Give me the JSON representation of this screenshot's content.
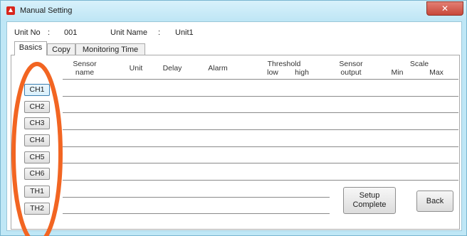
{
  "window": {
    "title": "Manual Setting",
    "close_symbol": "✕",
    "accent_color": "#bfe7f6"
  },
  "unit": {
    "no_label": "Unit No",
    "no_colon": ":",
    "no_value": "001",
    "name_label": "Unit Name",
    "name_colon": ":",
    "name_value": "Unit1"
  },
  "tabs": [
    {
      "label": "Basics",
      "active": true
    },
    {
      "label": "Copy",
      "active": false
    },
    {
      "label": "Monitoring Time",
      "active": false
    }
  ],
  "headers": {
    "sensor_name_1": "Sensor",
    "sensor_name_2": "name",
    "unit": "Unit",
    "delay": "Delay",
    "alarm": "Alarm",
    "threshold": "Threshold",
    "low": "low",
    "high": "high",
    "sensor_output_1": "Sensor",
    "sensor_output_2": "output",
    "scale": "Scale",
    "min": "Min",
    "max": "Max"
  },
  "channels": [
    "CH1",
    "CH2",
    "CH3",
    "CH4",
    "CH5",
    "CH6",
    "TH1",
    "TH2"
  ],
  "buttons": {
    "setup_line1": "Setup",
    "setup_line2": "Complete",
    "back": "Back"
  },
  "annotation_color": "#f26522"
}
